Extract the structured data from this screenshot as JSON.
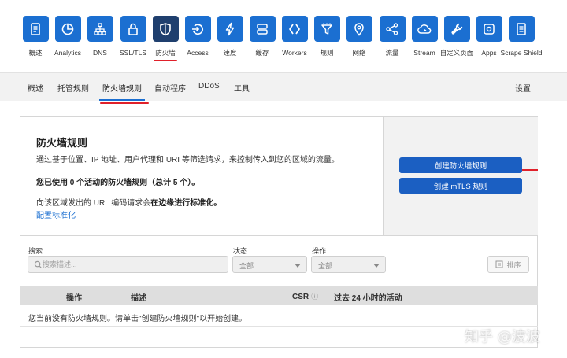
{
  "apps": [
    {
      "label": "概述",
      "icon": "document-icon"
    },
    {
      "label": "Analytics",
      "icon": "pie-chart-icon"
    },
    {
      "label": "DNS",
      "icon": "network-icon"
    },
    {
      "label": "SSL/TLS",
      "icon": "lock-icon"
    },
    {
      "label": "防火墙",
      "icon": "shield-icon",
      "active": true
    },
    {
      "label": "Access",
      "icon": "access-icon"
    },
    {
      "label": "速度",
      "icon": "lightning-icon"
    },
    {
      "label": "缓存",
      "icon": "server-icon"
    },
    {
      "label": "Workers",
      "icon": "workers-icon"
    },
    {
      "label": "规则",
      "icon": "funnel-icon"
    },
    {
      "label": "网络",
      "icon": "location-icon"
    },
    {
      "label": "流量",
      "icon": "traffic-icon"
    },
    {
      "label": "Stream",
      "icon": "cloud-play-icon"
    },
    {
      "label": "自定义页面",
      "icon": "wrench-icon"
    },
    {
      "label": "Apps",
      "icon": "apps-icon"
    },
    {
      "label": "Scrape Shield",
      "icon": "page-shield-icon"
    }
  ],
  "subnav": {
    "items": [
      "概述",
      "托管规则",
      "防火墙规则",
      "自动程序",
      "DDoS",
      "工具"
    ],
    "active": "防火墙规则",
    "settings": "设置"
  },
  "panel": {
    "title": "防火墙规则",
    "description": "通过基于位置、IP 地址、用户代理和 URI 等筛选请求，来控制传入到您的区域的流量。",
    "usage": "您已使用 0 个活动的防火墙规则（总计 5 个）。",
    "normalize_prefix": "向该区域发出的 URL 编码请求会",
    "normalize_bold": "在边缘进行标准化。",
    "normalize_link": "配置标准化",
    "create_button": "创建防火墙规则",
    "create_mtls_button": "创建 mTLS 规则"
  },
  "filters": {
    "search_label": "搜索",
    "search_placeholder": "搜索描述...",
    "status_label": "状态",
    "status_value": "全部",
    "action_label": "操作",
    "action_value": "全部",
    "sort_label": "排序"
  },
  "table": {
    "col_action": "操作",
    "col_desc": "描述",
    "col_csr": "CSR",
    "col_activity": "过去 24 小时的活动",
    "empty": "您当前没有防火墙规则。请单击\"创建防火墙规则\"以开始创建。"
  },
  "watermark": "知乎 @波波",
  "colors": {
    "brand_blue": "#1b6fd1",
    "active_tile": "#1f3f6e",
    "annotation_red": "#e0202a"
  }
}
